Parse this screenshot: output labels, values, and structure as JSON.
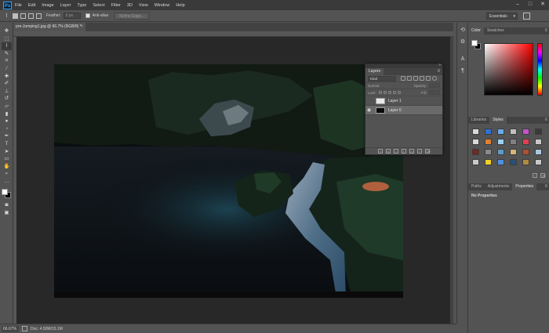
{
  "app": {
    "logo": "Ps"
  },
  "menu": [
    "File",
    "Edit",
    "Image",
    "Layer",
    "Type",
    "Select",
    "Filter",
    "3D",
    "View",
    "Window",
    "Help"
  ],
  "window_controls": [
    "–",
    "□",
    "✕"
  ],
  "options": {
    "feather_label": "Feather:",
    "feather_value": "0 px",
    "antialias_label": "Anti-alias",
    "refine_edge_label": "Refine Edge...",
    "workspace": "Essentials"
  },
  "document": {
    "tab_title": "pre-Jumping1.jpg @ 66.7% (RGB/8) *",
    "zoom": "66.67%",
    "doc_info": "Doc: 4.50M/15.1M"
  },
  "layers_panel": {
    "tab": "Layers",
    "filter_kind": "Kind",
    "blend_mode": "Normal",
    "opacity_label": "Opacity:",
    "lock_label": "Lock:",
    "fill_label": "Fill:",
    "layers": [
      {
        "name": "Layer 1",
        "visible": false,
        "selected": false,
        "thumb": "#e8e8e8"
      },
      {
        "name": "Layer 0",
        "visible": true,
        "selected": true,
        "thumb": "#0a0a0a"
      }
    ]
  },
  "dock": {
    "color_tabs": [
      "Color",
      "Swatches"
    ],
    "styles_tabs": [
      "Libraries",
      "Styles"
    ],
    "props_tabs": [
      "Paths",
      "Adjustments",
      "Properties"
    ],
    "props_title": "No Properties",
    "style_swatches": [
      "#d8d8d8",
      "#2f6fd6",
      "#6aa8e8",
      "#bfbfbf",
      "#c84fd0",
      "#3a3a3a",
      "#d8d8d8",
      "#e08030",
      "#9ad0f0",
      "#808080",
      "#e04050",
      "#c8c8c8",
      "#6f2a22",
      "#8a8a8a",
      "#5f9bc6",
      "#d3b57a",
      "#b05030",
      "#a9c8e0",
      "#c8c8c8",
      "#f0d020",
      "#4f8fe0",
      "#2b4f7a",
      "#b08a40",
      "#c8c8c8"
    ]
  },
  "colors": {
    "foreground": "#ffffff",
    "background": "#000000",
    "chrome_dark": "#3a3a3a",
    "panel": "#535353",
    "canvas_bg": "#282828"
  }
}
